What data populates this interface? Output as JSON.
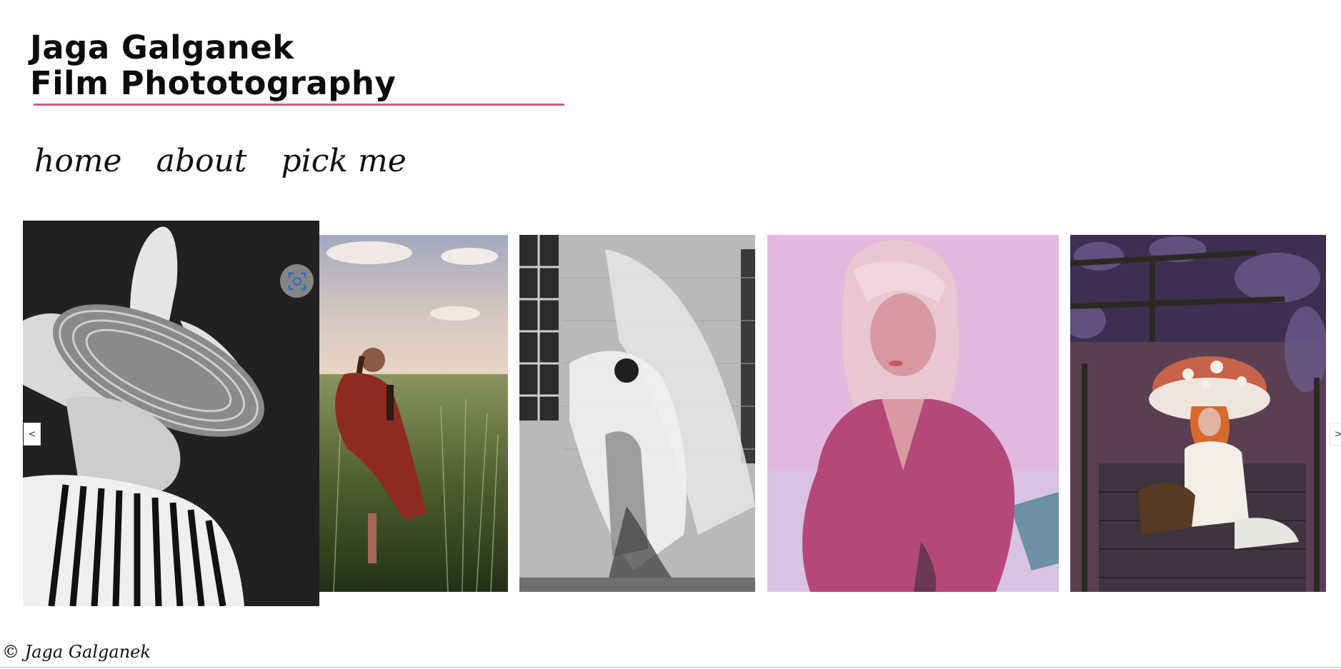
{
  "site": {
    "title_line1": "Jaga Galganek",
    "title_line2": "Film Phototography",
    "accent_color": "#d9578a"
  },
  "nav": {
    "items": [
      "home",
      "about",
      "pick me"
    ]
  },
  "gallery": {
    "prev_label": "<",
    "next_label": ">",
    "zoom_icon": "zoom-expand-icon",
    "photos": [
      {
        "description": "black and white portrait, woman in wide striped hat, striped top"
      },
      {
        "description": "woman in red coat standing in tall grass field under cloudy sky"
      },
      {
        "description": "black and white double exposure of dancer with fabric against brick wall"
      },
      {
        "description": "pink-toned portrait of blonde woman in pink dress"
      },
      {
        "description": "woman in mushroom hat sitting on steps among purple foliage"
      }
    ]
  },
  "footer": {
    "copyright": "© Jaga Galganek"
  }
}
